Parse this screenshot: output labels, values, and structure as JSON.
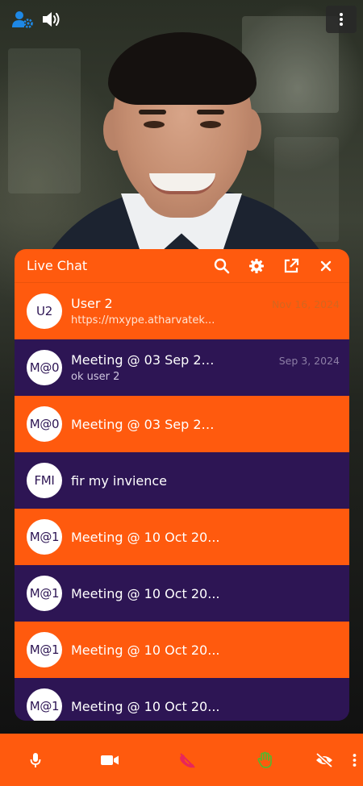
{
  "video": {
    "top_icons": [
      "participants-settings-icon",
      "speaker-icon",
      "more-vertical-icon"
    ]
  },
  "chat": {
    "title": "Live Chat",
    "header_icons": [
      "search-icon",
      "gear-icon",
      "external-link-icon",
      "close-icon"
    ],
    "items": [
      {
        "avatar": "U2",
        "name": "User 2",
        "date": "Nov 16, 2024",
        "preview": "https://mxype.atharvatek...",
        "theme": "orange"
      },
      {
        "avatar": "M@0",
        "name": "Meeting @ 03 Sep 20...",
        "date": "Sep 3, 2024",
        "preview": "ok user 2",
        "theme": "purple"
      },
      {
        "avatar": "M@0",
        "name": "Meeting @ 03 Sep 20...",
        "date": "",
        "preview": "",
        "theme": "orange"
      },
      {
        "avatar": "FMI",
        "name": "fir my invience",
        "date": "",
        "preview": "",
        "theme": "purple"
      },
      {
        "avatar": "M@1",
        "name": "Meeting @ 10 Oct 20...",
        "date": "",
        "preview": "",
        "theme": "orange"
      },
      {
        "avatar": "M@1",
        "name": "Meeting @ 10 Oct 20...",
        "date": "",
        "preview": "",
        "theme": "purple"
      },
      {
        "avatar": "M@1",
        "name": "Meeting @ 10 Oct 20...",
        "date": "",
        "preview": "",
        "theme": "orange"
      },
      {
        "avatar": "M@1",
        "name": "Meeting @ 10 Oct 20...",
        "date": "",
        "preview": "",
        "theme": "purple"
      }
    ]
  },
  "toolbar": {
    "buttons": [
      "microphone-icon",
      "video-camera-icon",
      "phone-hangup-icon",
      "raise-hand-icon",
      "hide-video-icon",
      "more-vertical-icon"
    ]
  },
  "colors": {
    "accent_orange": "#ff5a0e",
    "chat_purple": "#2d1554",
    "hangup_pink": "#e8275a",
    "hand_green": "#55b82e",
    "participants_blue": "#1e88e5"
  }
}
